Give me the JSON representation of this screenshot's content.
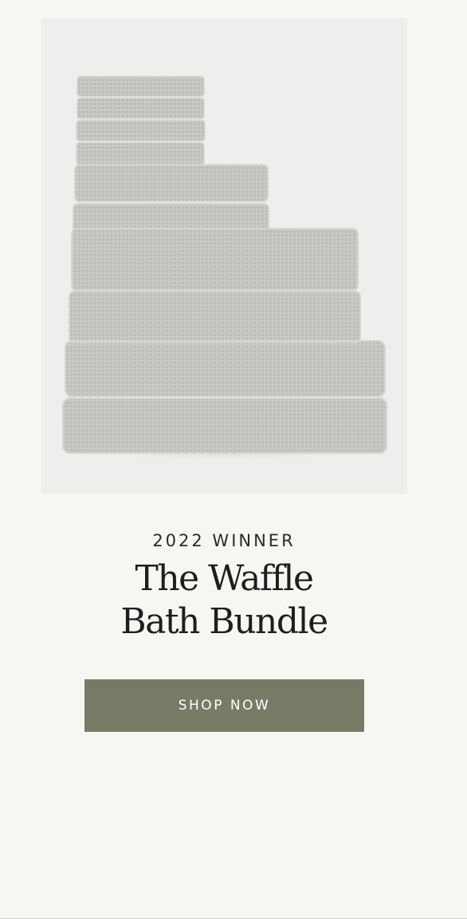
{
  "hero": {
    "image_alt": "Stack of light grey waffle-weave bath towels, washcloths and hand towels",
    "towel_color": "#c9c8c5",
    "background_color": "#eeeeec"
  },
  "promo": {
    "eyebrow": "2022 WINNER",
    "title_line1": "The Waffle",
    "title_line2": "Bath Bundle"
  },
  "cta": {
    "label": "SHOP NOW",
    "color": "#777b66"
  }
}
